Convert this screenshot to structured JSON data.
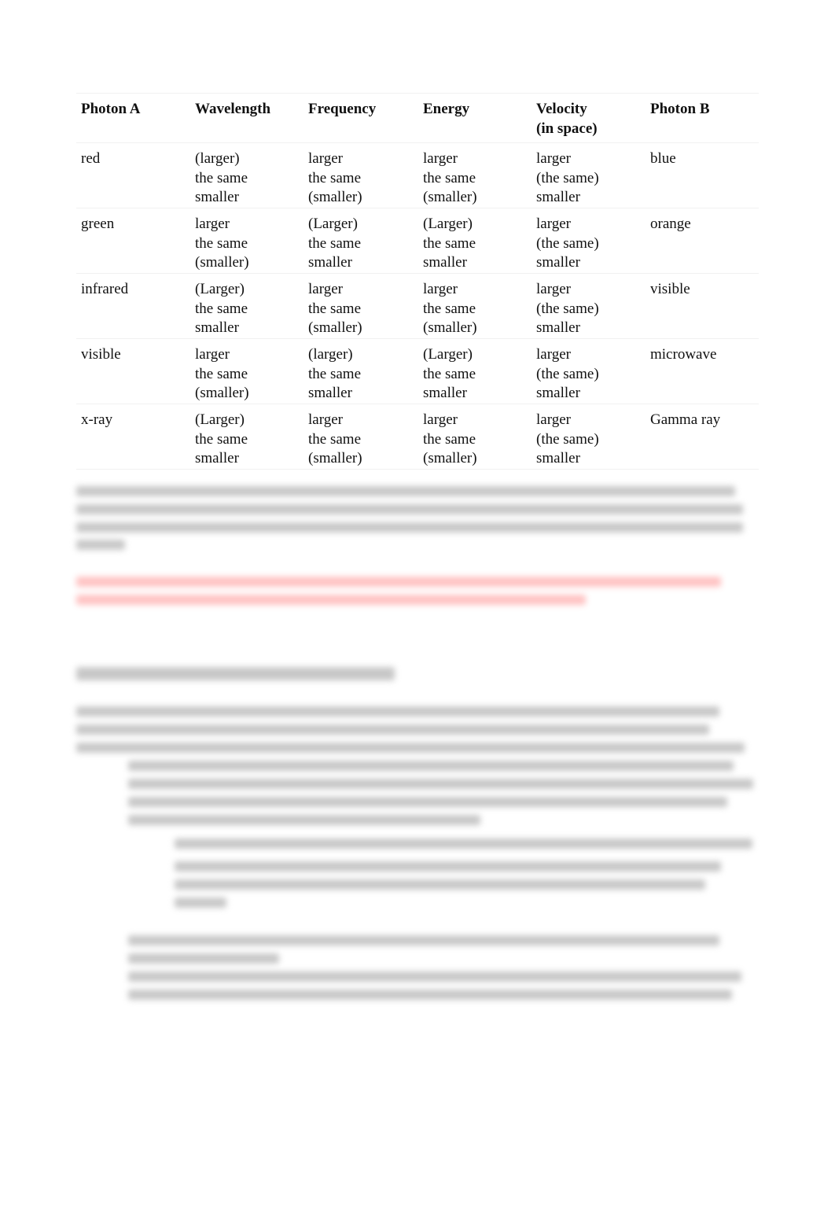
{
  "table": {
    "headers": [
      [
        "Photon A"
      ],
      [
        "Wavelength"
      ],
      [
        "Frequency"
      ],
      [
        "Energy"
      ],
      [
        "Velocity",
        "(in space)"
      ],
      [
        "Photon B"
      ]
    ],
    "rows": [
      {
        "photon_a": "red",
        "wavelength": [
          "(larger)",
          "the same",
          "smaller"
        ],
        "frequency": [
          "larger",
          "the same",
          "(smaller)"
        ],
        "energy": [
          "larger",
          "the same",
          "(smaller)"
        ],
        "velocity": [
          "larger",
          "(the same)",
          "smaller"
        ],
        "photon_b": "blue"
      },
      {
        "photon_a": "green",
        "wavelength": [
          "larger",
          "the same",
          "(smaller)"
        ],
        "frequency": [
          "(Larger)",
          "the same",
          "smaller"
        ],
        "energy": [
          "(Larger)",
          "the same",
          "smaller"
        ],
        "velocity": [
          "larger",
          "(the same)",
          "smaller"
        ],
        "photon_b": "orange"
      },
      {
        "photon_a": "infrared",
        "wavelength": [
          "(Larger)",
          "the same",
          "smaller"
        ],
        "frequency": [
          "larger",
          "the same",
          "(smaller)"
        ],
        "energy": [
          "larger",
          "the same",
          "(smaller)"
        ],
        "velocity": [
          "larger",
          "(the same)",
          "smaller"
        ],
        "photon_b": "visible"
      },
      {
        "photon_a": "visible",
        "wavelength": [
          "larger",
          "the same",
          "(smaller)"
        ],
        "frequency": [
          "(larger)",
          "the same",
          "smaller"
        ],
        "energy": [
          "(Larger)",
          "the same",
          "smaller"
        ],
        "velocity": [
          "larger",
          "(the same)",
          "smaller"
        ],
        "photon_b": "microwave"
      },
      {
        "photon_a": "x-ray",
        "wavelength": [
          "(Larger)",
          "the same",
          "smaller"
        ],
        "frequency": [
          "larger",
          "the same",
          "(smaller)"
        ],
        "energy": [
          "larger",
          "the same",
          "(smaller)"
        ],
        "velocity": [
          "larger",
          "(the same)",
          "smaller"
        ],
        "photon_b": "Gamma ray"
      }
    ]
  },
  "colors": {
    "answer_text": "#ff4d4d",
    "body_text": "#111111"
  }
}
